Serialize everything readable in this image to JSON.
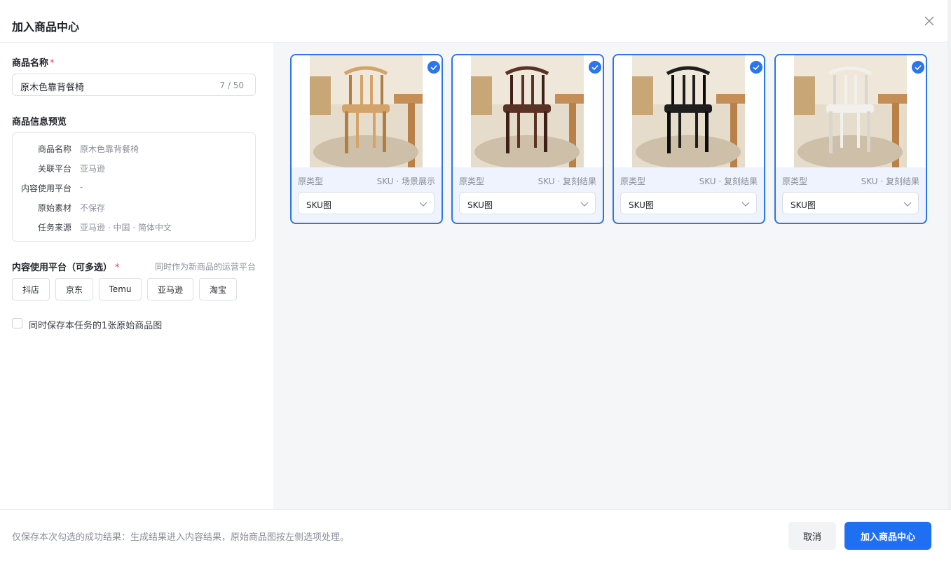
{
  "dialog": {
    "title": "加入商品中心"
  },
  "form": {
    "name_label": "商品名称",
    "required_mark": "*",
    "name_value": "原木色靠背餐椅",
    "name_counter": "7 / 50",
    "preview_label": "商品信息预览",
    "preview": [
      {
        "key": "商品名称",
        "value": "原木色靠背餐椅"
      },
      {
        "key": "关联平台",
        "value": "亚马逊"
      },
      {
        "key": "内容使用平台",
        "value": "-"
      },
      {
        "key": "原始素材",
        "value": "不保存"
      },
      {
        "key": "任务来源",
        "value": "亚马逊 · 中国 · 简体中文"
      }
    ],
    "platform_label": "内容使用平台（可多选）",
    "platform_hint": "同时作为新商品的运营平台",
    "platforms": [
      "抖店",
      "京东",
      "Temu",
      "亚马逊",
      "淘宝"
    ],
    "save_original_label": "同时保存本任务的1张原始商品图"
  },
  "cards": [
    {
      "left_meta": "原类型",
      "right_meta": "SKU · 场景展示",
      "select": "SKU图",
      "chair_color": "#d4a36a",
      "chair_dark": "#b07f45",
      "icon": "chair-natural-image"
    },
    {
      "left_meta": "原类型",
      "right_meta": "SKU · 复刻结果",
      "select": "SKU图",
      "chair_color": "#5a3326",
      "chair_dark": "#3e2018",
      "icon": "chair-walnut-image"
    },
    {
      "left_meta": "原类型",
      "right_meta": "SKU · 复刻结果",
      "select": "SKU图",
      "chair_color": "#1e1e1e",
      "chair_dark": "#0c0c0c",
      "icon": "chair-black-image"
    },
    {
      "left_meta": "原类型",
      "right_meta": "SKU · 复刻结果",
      "select": "SKU图",
      "chair_color": "#f2f0ec",
      "chair_dark": "#d9d5cf",
      "icon": "chair-white-image"
    }
  ],
  "footer": {
    "note": "仅保存本次勾选的成功结果：生成结果进入内容结果，原始商品图按左侧选项处理。",
    "cancel": "取消",
    "confirm": "加入商品中心"
  },
  "colors": {
    "accent": "#1f6ff2",
    "card_border": "#2b75ef",
    "required": "#e5484d"
  }
}
